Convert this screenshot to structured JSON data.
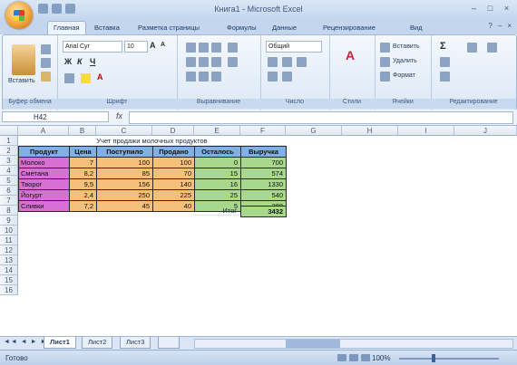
{
  "window": {
    "title": "Книга1 - Microsoft Excel",
    "controls": [
      "–",
      "□",
      "×"
    ]
  },
  "ribbon_tabs": [
    "Главная",
    "Вставка",
    "Разметка страницы",
    "Формулы",
    "Данные",
    "Рецензирование",
    "Вид"
  ],
  "ribbon": {
    "clipboard": {
      "paste": "Вставить",
      "label": "Буфер обмена"
    },
    "font": {
      "name": "Arial Cyr",
      "size": "10",
      "label": "Шрифт"
    },
    "alignment": {
      "label": "Выравнивание"
    },
    "number": {
      "format": "Общий",
      "label": "Число"
    },
    "styles": {
      "label": "Стили"
    },
    "cells": {
      "insert": "Вставить",
      "delete": "Удалить",
      "format": "Формат",
      "label": "Ячейки"
    },
    "editing": {
      "label": "Редактирование"
    }
  },
  "formula_bar": {
    "name_box": "H42",
    "fx": "fx",
    "value": ""
  },
  "columns": [
    "A",
    "B",
    "C",
    "D",
    "E",
    "F",
    "G",
    "H",
    "I",
    "J"
  ],
  "rows": [
    "1",
    "2",
    "3",
    "4",
    "5",
    "6",
    "7",
    "8",
    "9",
    "10",
    "11",
    "12",
    "13",
    "14",
    "15",
    "16"
  ],
  "sheet": {
    "title": "Учет продажи молочных продуктов",
    "headers": [
      "Продукт",
      "Цена",
      "Поступило",
      "Продано",
      "Осталось",
      "Выручка"
    ],
    "data": [
      [
        "Молоко",
        "7",
        "100",
        "100",
        "0",
        "700"
      ],
      [
        "Сметана",
        "8,2",
        "85",
        "70",
        "15",
        "574"
      ],
      [
        "Творог",
        "9,5",
        "156",
        "140",
        "16",
        "1330"
      ],
      [
        "Йогурт",
        "2,4",
        "250",
        "225",
        "25",
        "540"
      ],
      [
        "Сливки",
        "7,2",
        "45",
        "40",
        "5",
        "288"
      ]
    ],
    "total_label": "Итог",
    "total_value": "3432"
  },
  "sheet_tabs": [
    "Лист1",
    "Лист2",
    "Лист3"
  ],
  "status": {
    "text": "Готово",
    "zoom": "100%"
  }
}
